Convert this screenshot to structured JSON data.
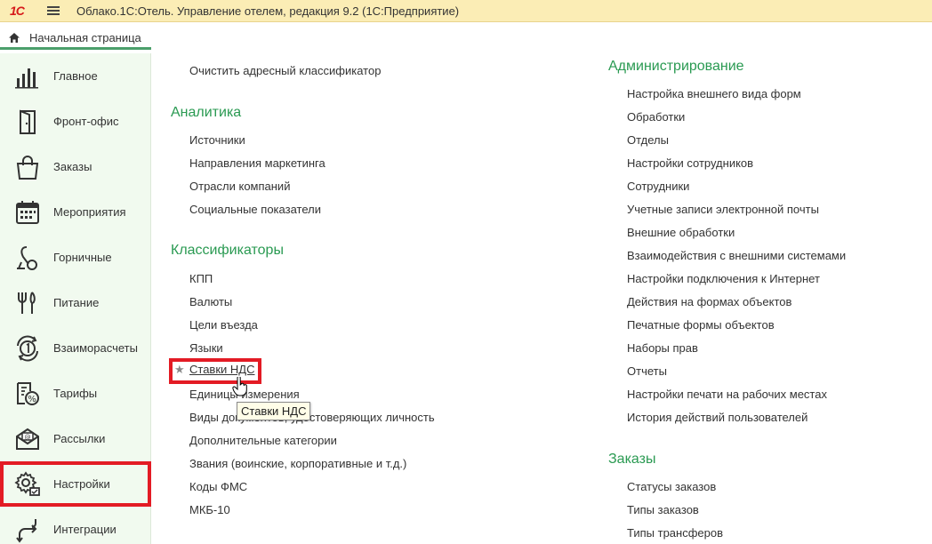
{
  "titlebar": {
    "logo": "1С",
    "title": "Облако.1С:Отель. Управление отелем, редакция 9.2  (1С:Предприятие)"
  },
  "home_tab": {
    "label": "Начальная страница"
  },
  "sidebar": {
    "items": [
      {
        "label": "Главное",
        "icon": "bar-chart-icon"
      },
      {
        "label": "Фронт-офис",
        "icon": "door-icon"
      },
      {
        "label": "Заказы",
        "icon": "shopping-bag-icon"
      },
      {
        "label": "Мероприятия",
        "icon": "calendar-icon"
      },
      {
        "label": "Горничные",
        "icon": "vacuum-cleaner-icon"
      },
      {
        "label": "Питание",
        "icon": "cutlery-icon"
      },
      {
        "label": "Взаиморасчеты",
        "icon": "settlement-icon"
      },
      {
        "label": "Тарифы",
        "icon": "tariff-icon"
      },
      {
        "label": "Рассылки",
        "icon": "mail-icon"
      },
      {
        "label": "Настройки",
        "icon": "gear-icon"
      },
      {
        "label": "Интеграции",
        "icon": "integration-icon"
      }
    ]
  },
  "left_column": {
    "top_link": "Очистить адресный классификатор",
    "analytics": {
      "title": "Аналитика",
      "links": [
        "Источники",
        "Направления маркетинга",
        "Отрасли компаний",
        "Социальные показатели"
      ]
    },
    "classifiers": {
      "title": "Классификаторы",
      "links_before": [
        "КПП",
        "Валюты",
        "Цели въезда",
        "Языки"
      ],
      "highlighted": "Ставки НДС",
      "links_after": [
        "Единицы измерения",
        "Виды документов, удостоверяющих личность",
        "Дополнительные категории",
        "Звания (воинские, корпоративные и т.д.)",
        "Коды ФМС",
        "МКБ-10"
      ]
    }
  },
  "tooltip": {
    "text": "Ставки НДС"
  },
  "right_column": {
    "administration": {
      "title": "Администрирование",
      "links": [
        "Настройка внешнего вида форм",
        "Обработки",
        "Отделы",
        "Настройки сотрудников",
        "Сотрудники",
        "Учетные записи электронной почты",
        "Внешние обработки",
        "Взаимодействия с внешними системами",
        "Настройки подключения к Интернет",
        "Действия на формах объектов",
        "Печатные формы объектов",
        "Наборы прав",
        "Отчеты",
        "Настройки печати на рабочих местах",
        "История действий пользователей"
      ]
    },
    "orders": {
      "title": "Заказы",
      "links": [
        "Статусы заказов",
        "Типы заказов",
        "Типы трансферов"
      ]
    }
  },
  "colors": {
    "section_title": "#2a9a52",
    "highlight": "#e31b24",
    "titlebar": "#fbedb5",
    "sidebar": "#f1faef",
    "home_tab_underline": "#4b9f6b"
  }
}
